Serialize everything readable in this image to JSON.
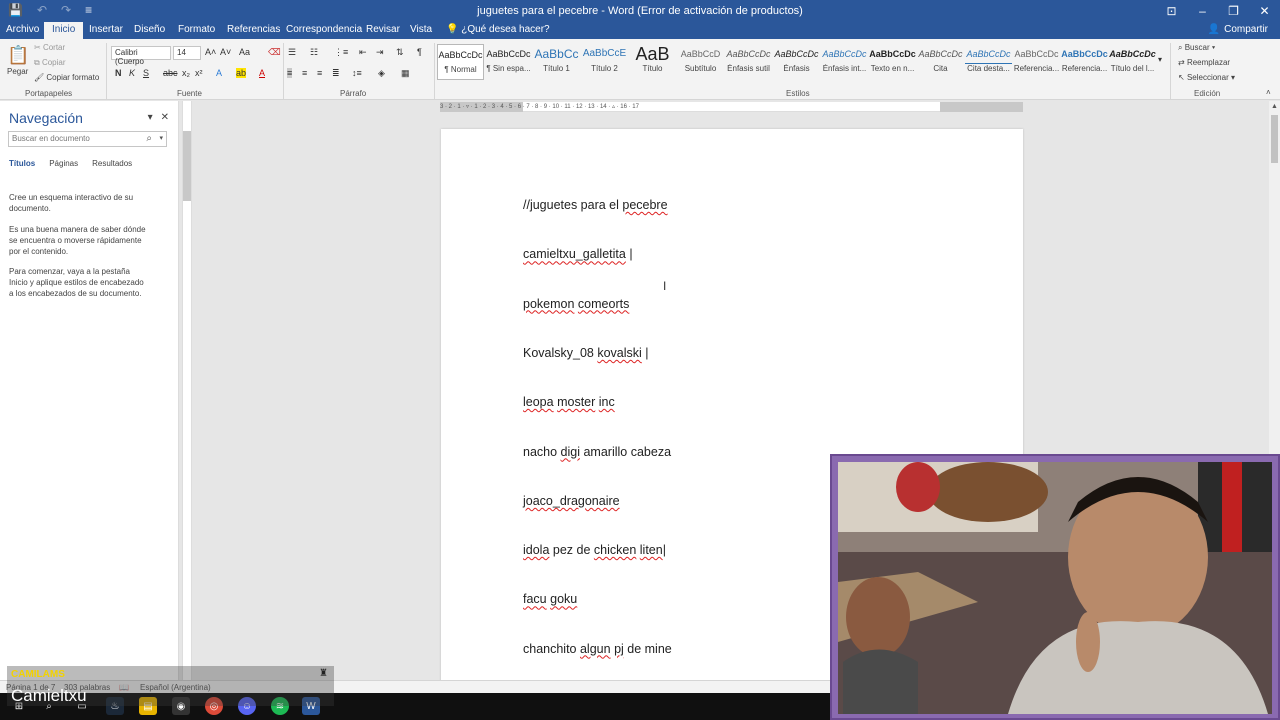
{
  "titlebar": {
    "doc_title": "juguetes para el pecebre - Word (Error de activación de productos)"
  },
  "tabs": [
    {
      "label": "Archivo",
      "active": false
    },
    {
      "label": "Inicio",
      "active": true
    },
    {
      "label": "Insertar",
      "active": false
    },
    {
      "label": "Diseño",
      "active": false
    },
    {
      "label": "Formato",
      "active": false
    },
    {
      "label": "Referencias",
      "active": false
    },
    {
      "label": "Correspondencia",
      "active": false
    },
    {
      "label": "Revisar",
      "active": false
    },
    {
      "label": "Vista",
      "active": false
    }
  ],
  "tell_me": "¿Qué desea hacer?",
  "share": "Compartir",
  "ribbon": {
    "clipboard": {
      "paste": "Pegar",
      "cut": "Cortar",
      "copy": "Copiar",
      "format_painter": "Copiar formato",
      "group": "Portapapeles"
    },
    "font": {
      "name": "Calibri (Cuerpo",
      "size": "14",
      "group": "Fuente"
    },
    "paragraph": {
      "group": "Párrafo"
    },
    "styles": {
      "group": "Estilos",
      "items": [
        {
          "preview": "AaBbCcDc",
          "name": "¶ Normal"
        },
        {
          "preview": "AaBbCcDc",
          "name": "¶ Sin espa..."
        },
        {
          "preview": "AaBbCc",
          "name": "Título 1"
        },
        {
          "preview": "AaBbCcE",
          "name": "Título 2"
        },
        {
          "preview": "AaB",
          "name": "Título"
        },
        {
          "preview": "AaBbCcD",
          "name": "Subtítulo"
        },
        {
          "preview": "AaBbCcDc",
          "name": "Énfasis sutil"
        },
        {
          "preview": "AaBbCcDc",
          "name": "Énfasis"
        },
        {
          "preview": "AaBbCcDc",
          "name": "Énfasis int..."
        },
        {
          "preview": "AaBbCcDc",
          "name": "Texto en n..."
        },
        {
          "preview": "AaBbCcDc",
          "name": "Cita"
        },
        {
          "preview": "AaBbCcDc",
          "name": "Cita desta..."
        },
        {
          "preview": "AaBbCcDc",
          "name": "Referencia..."
        },
        {
          "preview": "AaBbCcDc",
          "name": "Referencia..."
        },
        {
          "preview": "AaBbCcDc",
          "name": "Título del l..."
        }
      ]
    },
    "editing": {
      "find": "Buscar",
      "replace": "Reemplazar",
      "select": "Seleccionar",
      "group": "Edición"
    }
  },
  "nav": {
    "title": "Navegación",
    "search_placeholder": "Buscar en documento",
    "tabs": [
      "Títulos",
      "Páginas",
      "Resultados"
    ],
    "para1": "Cree un esquema interactivo de su documento.",
    "para2": "Es una buena manera de saber dónde se encuentra o moverse rápidamente por el contenido.",
    "para3": "Para comenzar, vaya a la pestaña Inicio y aplique estilos de encabezado a los encabezados de su documento."
  },
  "ruler_numbers": "3 · 2 · 1 · ▿ · 1 · 2 · 3 · 4 · 5 · 6 · 7 · 8 · 9 · 10 · 11 · 12 · 13 · 14 · ▵ · 16 · 17",
  "document": {
    "lines": [
      [
        {
          "t": "//juguetes para el "
        },
        {
          "t": "pecebre",
          "sp": true
        }
      ],
      [
        {
          "t": "camieltxu_galletita",
          "sp": true
        },
        {
          "t": " |"
        }
      ],
      [
        {
          "t": "pokemon",
          "sp": true
        },
        {
          "t": " "
        },
        {
          "t": "comeorts",
          "sp": true
        }
      ],
      [
        {
          "t": "Kovalsky_08 "
        },
        {
          "t": "kovalski",
          "sp": true
        },
        {
          "t": " |"
        }
      ],
      [
        {
          "t": "leopa",
          "sp": true
        },
        {
          "t": " "
        },
        {
          "t": "moster",
          "sp": true
        },
        {
          "t": " "
        },
        {
          "t": "inc",
          "sp": true
        }
      ],
      [
        {
          "t": "nacho "
        },
        {
          "t": "digi",
          "sp": true
        },
        {
          "t": " amarillo cabeza"
        }
      ],
      [
        {
          "t": "joaco_dragonaire",
          "sp": true
        }
      ],
      [
        {
          "t": "idola",
          "sp": true
        },
        {
          "t": " pez de "
        },
        {
          "t": "chicken",
          "sp": true
        },
        {
          "t": " "
        },
        {
          "t": "liten",
          "sp": true
        },
        {
          "t": "|"
        }
      ],
      [
        {
          "t": "facu",
          "sp": true
        },
        {
          "t": " "
        },
        {
          "t": "goku",
          "sp": true
        }
      ],
      [
        {
          "t": "chanchito "
        },
        {
          "t": "algun",
          "sp": true
        },
        {
          "t": " "
        },
        {
          "t": "pj",
          "sp": true
        },
        {
          "t": " de mine"
        }
      ]
    ]
  },
  "status": {
    "page": "Página 1 de 7",
    "words": "303 palabras",
    "language": "Español (Argentina)"
  },
  "overlay": {
    "tag": "CAMILAMS",
    "name": "Camieltxu"
  },
  "colors": {
    "word_blue": "#2b579a",
    "spell_underline": "#dd2222",
    "overlay_tag": "#f2d200"
  }
}
